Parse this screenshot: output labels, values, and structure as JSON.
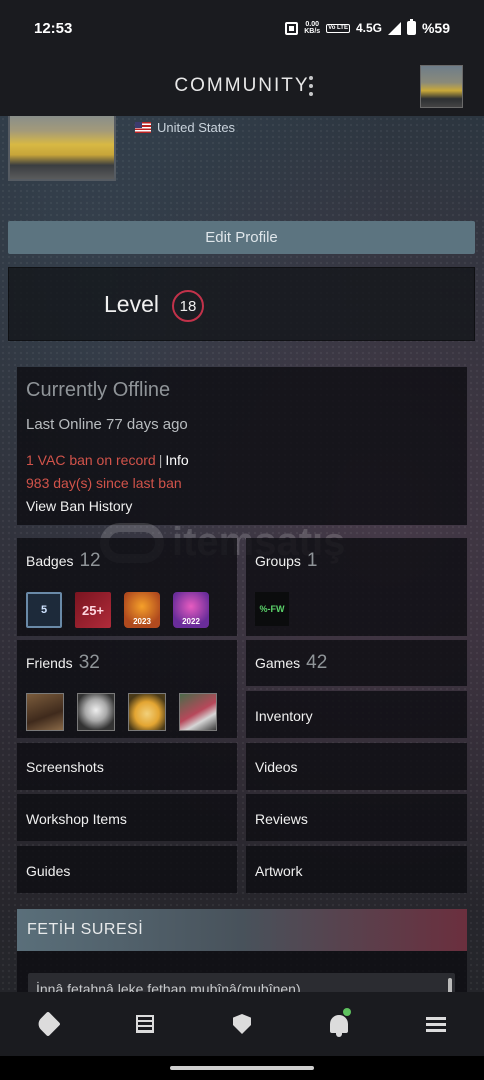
{
  "status_bar": {
    "time": "12:53",
    "speed_top": "0.00",
    "speed_bottom": "KB/s",
    "volte": "Vo LTE",
    "network": "4.5G",
    "battery_pct": "%59"
  },
  "header": {
    "title": "COMMUNITY"
  },
  "profile": {
    "location": "United States",
    "edit_label": "Edit Profile",
    "level_label": "Level",
    "level_value": "18"
  },
  "status": {
    "state": "Currently Offline",
    "last_online": "Last Online 77 days ago",
    "vac": "1 VAC ban on record",
    "vac_sep": "|",
    "vac_info": "Info",
    "days_since": "983 day(s) since last ban",
    "ban_history": "View Ban History"
  },
  "tiles": {
    "badges_label": "Badges",
    "badges_count": "12",
    "badge_items": [
      {
        "icon": "badge-5-icon",
        "text": "5"
      },
      {
        "icon": "badge-25plus-icon",
        "text": "25+"
      },
      {
        "icon": "badge-2023-icon",
        "text": "2023"
      },
      {
        "icon": "badge-2022-icon",
        "text": "2022"
      }
    ],
    "groups_label": "Groups",
    "groups_count": "1",
    "friends_label": "Friends",
    "friends_count": "32",
    "games_label": "Games",
    "games_count": "42",
    "inventory": "Inventory",
    "screenshots": "Screenshots",
    "videos": "Videos",
    "workshop": "Workshop Items",
    "reviews": "Reviews",
    "guides": "Guides",
    "artwork": "Artwork"
  },
  "summary": {
    "title": "FETİH SURESİ",
    "text": "İnnâ fetahnâ leke fethan mubînâ(mubînen)"
  },
  "watermark": "itemsatış",
  "bottom_nav": [
    {
      "icon": "tag-icon"
    },
    {
      "icon": "news-icon"
    },
    {
      "icon": "shield-icon"
    },
    {
      "icon": "bell-icon"
    },
    {
      "icon": "menu-icon"
    }
  ],
  "colors": {
    "accent_red": "#d1534a",
    "level_ring": "#c2324a",
    "edit_button": "#5c7480",
    "notification_dot": "#5ec25e"
  }
}
